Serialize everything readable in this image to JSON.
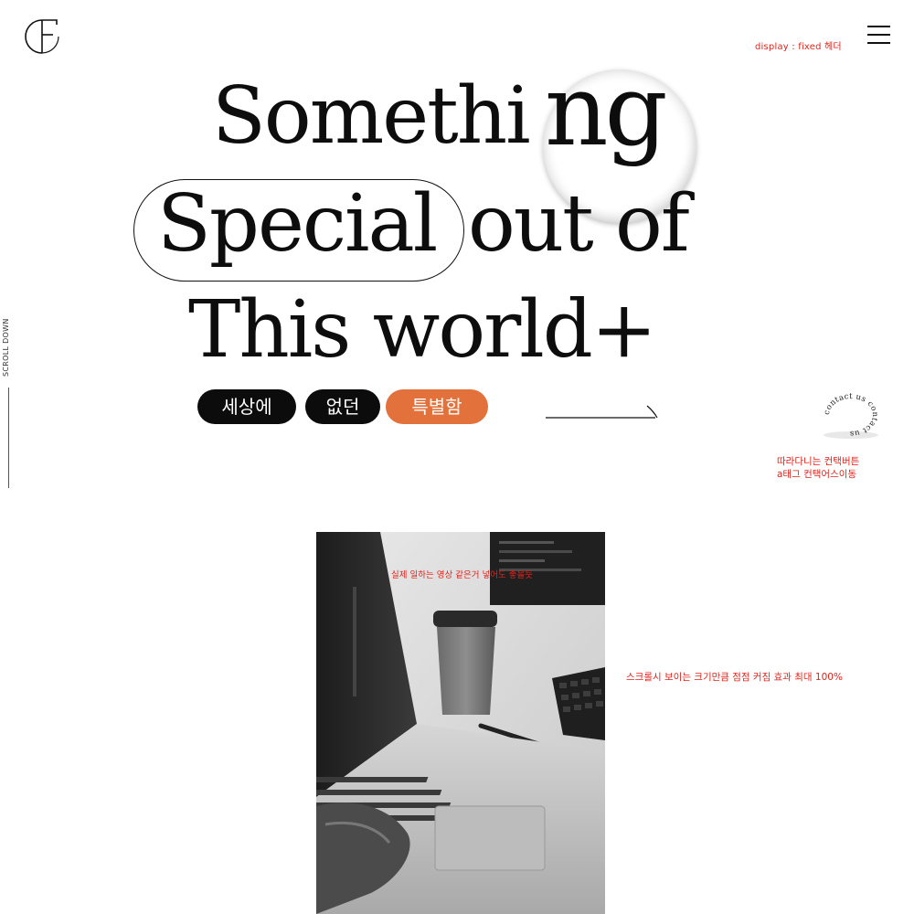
{
  "header": {
    "logo_icon": "cf-monogram-logo",
    "note": "display : fixed 헤더",
    "menu_icon": "hamburger-menu-icon"
  },
  "sidebar": {
    "scroll_label": "SCROLL DOWN"
  },
  "hero": {
    "line1_start": "Somethi",
    "line1_end": "ng",
    "line2_highlight": "Special",
    "line2_rest": "out of",
    "line3": "This world+",
    "pills": [
      {
        "label": "세상에",
        "color": "#0c0c0c"
      },
      {
        "label": "없던",
        "color": "#0c0c0c"
      },
      {
        "label": "특별함",
        "color": "#e3713b"
      }
    ],
    "arrow_icon": "arrow-right-line-icon"
  },
  "contact": {
    "badge_text": "contact us contact us",
    "note_line1": "따라다니는 컨택버튼",
    "note_line2": "a태그 컨택어스이동"
  },
  "media": {
    "image_desc_icon": "laptop-photo",
    "overlay_note": "실제 일하는 영상 같은거 넣어도 좋을듯",
    "scroll_note": "스크롤시 보이는 크기만큼 점점 커짐 효과 최대 100%"
  },
  "colors": {
    "accent_orange": "#e3713b",
    "annotation_red": "#e0231c",
    "ink": "#0d0d0d"
  }
}
